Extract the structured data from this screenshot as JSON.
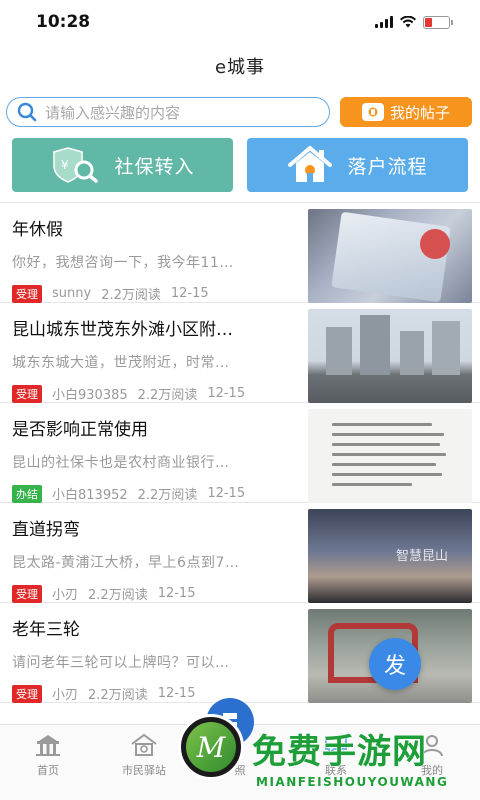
{
  "status_bar": {
    "time": "10:28"
  },
  "nav": {
    "title": "e城事"
  },
  "search": {
    "placeholder": "请输入感兴趣的内容",
    "my_posts_label": "我的帖子"
  },
  "quick_actions": {
    "social_security": "社保转入",
    "hukou": "落户流程"
  },
  "posts": [
    {
      "title": "年休假",
      "desc": "你好，我想咨询一下，我今年11…",
      "tag": "受理",
      "author": "sunny",
      "reads": "2.2万阅读",
      "date": "12-15"
    },
    {
      "title": "昆山城东世茂东外滩小区附…",
      "desc": "城东东城大道，世茂附近，时常…",
      "tag": "受理",
      "author": "小白930385",
      "reads": "2.2万阅读",
      "date": "12-15"
    },
    {
      "title": "是否影响正常使用",
      "desc": "昆山的社保卡也是农村商业银行…",
      "tag": "办结",
      "author": "小白813952",
      "reads": "2.2万阅读",
      "date": "12-15"
    },
    {
      "title": "直道拐弯",
      "desc": "昆太路-黄浦江大桥，早上6点到7…",
      "tag": "受理",
      "author": "小刃",
      "reads": "2.2万阅读",
      "date": "12-15",
      "thumb_watermark": "智慧昆山"
    },
    {
      "title": "老年三轮",
      "desc": "请问老年三轮可以上牌吗？可以…",
      "tag": "受理",
      "author": "小刃",
      "reads": "2.2万阅读",
      "date": "12-15"
    }
  ],
  "fab": {
    "label": "发"
  },
  "tabs": [
    {
      "label": "首页"
    },
    {
      "label": "市民驿站"
    },
    {
      "label": "照"
    },
    {
      "label": "联系"
    },
    {
      "label": "我的"
    }
  ],
  "watermark": {
    "letter": "M",
    "title": "免费手游网",
    "subtitle": "MIANFEISHOUYOUWANG"
  },
  "colors": {
    "accent_blue": "#5aacea",
    "accent_green": "#62b8a6",
    "accent_orange": "#f7941d",
    "tag_red": "#e02828",
    "tag_green": "#36b34a"
  }
}
